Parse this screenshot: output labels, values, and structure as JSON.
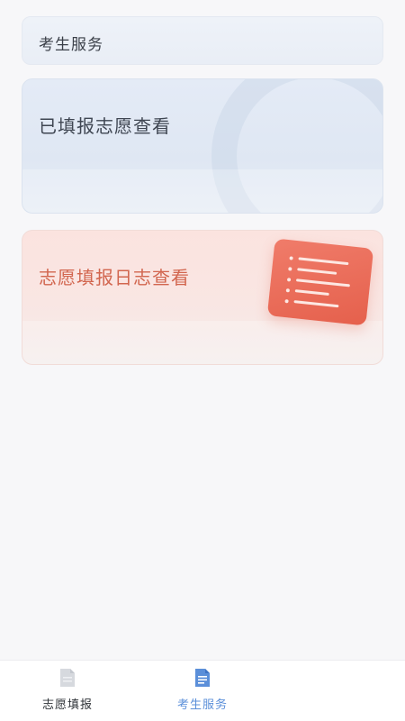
{
  "header": {
    "title": "考生服务"
  },
  "cards": [
    {
      "title": "已填报志愿查看",
      "theme": "blue"
    },
    {
      "title": "志愿填报日志查看",
      "theme": "red"
    }
  ],
  "tabbar": {
    "items": [
      {
        "label": "志愿填报",
        "icon": "document-icon",
        "active": false
      },
      {
        "label": "考生服务",
        "icon": "document-list-icon",
        "active": true
      }
    ]
  },
  "colors": {
    "accent_blue": "#5b8fd9",
    "card_red_text": "#d2664f",
    "card_red_doc": "#e5604c",
    "inactive_icon": "#c9ccd2"
  }
}
